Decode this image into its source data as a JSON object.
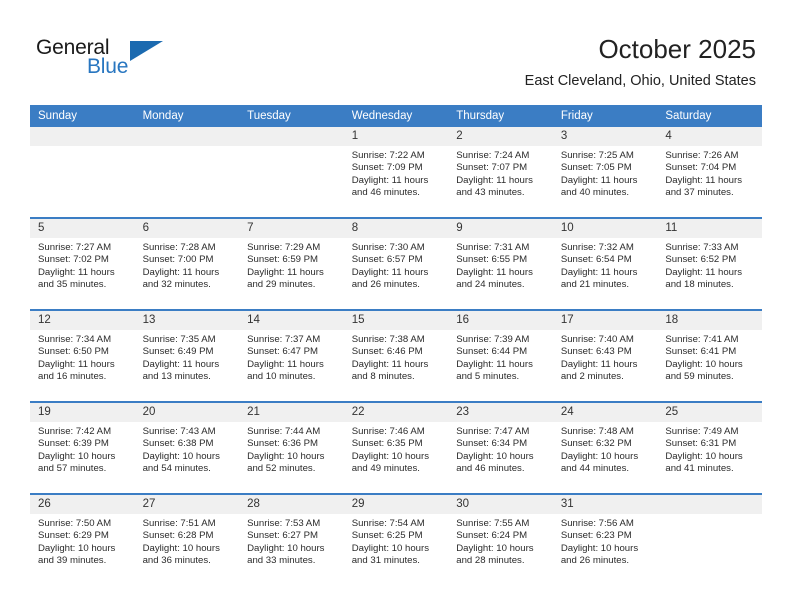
{
  "brand": {
    "name_part1": "General",
    "name_part2": "Blue",
    "triangle_icon": "triangle-icon",
    "accent_color": "#1b6ab0",
    "text_color": "#2876c0"
  },
  "header": {
    "title": "October 2025",
    "subtitle": "East Cleveland, Ohio, United States"
  },
  "calendar": {
    "header_bg": "#3b7dc4",
    "daynum_bg": "#f0f0f0",
    "weekdays": [
      "Sunday",
      "Monday",
      "Tuesday",
      "Wednesday",
      "Thursday",
      "Friday",
      "Saturday"
    ],
    "weeks": [
      [
        {
          "day": "",
          "lines": []
        },
        {
          "day": "",
          "lines": []
        },
        {
          "day": "",
          "lines": []
        },
        {
          "day": "1",
          "lines": [
            "Sunrise: 7:22 AM",
            "Sunset: 7:09 PM",
            "Daylight: 11 hours and 46 minutes."
          ]
        },
        {
          "day": "2",
          "lines": [
            "Sunrise: 7:24 AM",
            "Sunset: 7:07 PM",
            "Daylight: 11 hours and 43 minutes."
          ]
        },
        {
          "day": "3",
          "lines": [
            "Sunrise: 7:25 AM",
            "Sunset: 7:05 PM",
            "Daylight: 11 hours and 40 minutes."
          ]
        },
        {
          "day": "4",
          "lines": [
            "Sunrise: 7:26 AM",
            "Sunset: 7:04 PM",
            "Daylight: 11 hours and 37 minutes."
          ]
        }
      ],
      [
        {
          "day": "5",
          "lines": [
            "Sunrise: 7:27 AM",
            "Sunset: 7:02 PM",
            "Daylight: 11 hours and 35 minutes."
          ]
        },
        {
          "day": "6",
          "lines": [
            "Sunrise: 7:28 AM",
            "Sunset: 7:00 PM",
            "Daylight: 11 hours and 32 minutes."
          ]
        },
        {
          "day": "7",
          "lines": [
            "Sunrise: 7:29 AM",
            "Sunset: 6:59 PM",
            "Daylight: 11 hours and 29 minutes."
          ]
        },
        {
          "day": "8",
          "lines": [
            "Sunrise: 7:30 AM",
            "Sunset: 6:57 PM",
            "Daylight: 11 hours and 26 minutes."
          ]
        },
        {
          "day": "9",
          "lines": [
            "Sunrise: 7:31 AM",
            "Sunset: 6:55 PM",
            "Daylight: 11 hours and 24 minutes."
          ]
        },
        {
          "day": "10",
          "lines": [
            "Sunrise: 7:32 AM",
            "Sunset: 6:54 PM",
            "Daylight: 11 hours and 21 minutes."
          ]
        },
        {
          "day": "11",
          "lines": [
            "Sunrise: 7:33 AM",
            "Sunset: 6:52 PM",
            "Daylight: 11 hours and 18 minutes."
          ]
        }
      ],
      [
        {
          "day": "12",
          "lines": [
            "Sunrise: 7:34 AM",
            "Sunset: 6:50 PM",
            "Daylight: 11 hours and 16 minutes."
          ]
        },
        {
          "day": "13",
          "lines": [
            "Sunrise: 7:35 AM",
            "Sunset: 6:49 PM",
            "Daylight: 11 hours and 13 minutes."
          ]
        },
        {
          "day": "14",
          "lines": [
            "Sunrise: 7:37 AM",
            "Sunset: 6:47 PM",
            "Daylight: 11 hours and 10 minutes."
          ]
        },
        {
          "day": "15",
          "lines": [
            "Sunrise: 7:38 AM",
            "Sunset: 6:46 PM",
            "Daylight: 11 hours and 8 minutes."
          ]
        },
        {
          "day": "16",
          "lines": [
            "Sunrise: 7:39 AM",
            "Sunset: 6:44 PM",
            "Daylight: 11 hours and 5 minutes."
          ]
        },
        {
          "day": "17",
          "lines": [
            "Sunrise: 7:40 AM",
            "Sunset: 6:43 PM",
            "Daylight: 11 hours and 2 minutes."
          ]
        },
        {
          "day": "18",
          "lines": [
            "Sunrise: 7:41 AM",
            "Sunset: 6:41 PM",
            "Daylight: 10 hours and 59 minutes."
          ]
        }
      ],
      [
        {
          "day": "19",
          "lines": [
            "Sunrise: 7:42 AM",
            "Sunset: 6:39 PM",
            "Daylight: 10 hours and 57 minutes."
          ]
        },
        {
          "day": "20",
          "lines": [
            "Sunrise: 7:43 AM",
            "Sunset: 6:38 PM",
            "Daylight: 10 hours and 54 minutes."
          ]
        },
        {
          "day": "21",
          "lines": [
            "Sunrise: 7:44 AM",
            "Sunset: 6:36 PM",
            "Daylight: 10 hours and 52 minutes."
          ]
        },
        {
          "day": "22",
          "lines": [
            "Sunrise: 7:46 AM",
            "Sunset: 6:35 PM",
            "Daylight: 10 hours and 49 minutes."
          ]
        },
        {
          "day": "23",
          "lines": [
            "Sunrise: 7:47 AM",
            "Sunset: 6:34 PM",
            "Daylight: 10 hours and 46 minutes."
          ]
        },
        {
          "day": "24",
          "lines": [
            "Sunrise: 7:48 AM",
            "Sunset: 6:32 PM",
            "Daylight: 10 hours and 44 minutes."
          ]
        },
        {
          "day": "25",
          "lines": [
            "Sunrise: 7:49 AM",
            "Sunset: 6:31 PM",
            "Daylight: 10 hours and 41 minutes."
          ]
        }
      ],
      [
        {
          "day": "26",
          "lines": [
            "Sunrise: 7:50 AM",
            "Sunset: 6:29 PM",
            "Daylight: 10 hours and 39 minutes."
          ]
        },
        {
          "day": "27",
          "lines": [
            "Sunrise: 7:51 AM",
            "Sunset: 6:28 PM",
            "Daylight: 10 hours and 36 minutes."
          ]
        },
        {
          "day": "28",
          "lines": [
            "Sunrise: 7:53 AM",
            "Sunset: 6:27 PM",
            "Daylight: 10 hours and 33 minutes."
          ]
        },
        {
          "day": "29",
          "lines": [
            "Sunrise: 7:54 AM",
            "Sunset: 6:25 PM",
            "Daylight: 10 hours and 31 minutes."
          ]
        },
        {
          "day": "30",
          "lines": [
            "Sunrise: 7:55 AM",
            "Sunset: 6:24 PM",
            "Daylight: 10 hours and 28 minutes."
          ]
        },
        {
          "day": "31",
          "lines": [
            "Sunrise: 7:56 AM",
            "Sunset: 6:23 PM",
            "Daylight: 10 hours and 26 minutes."
          ]
        },
        {
          "day": "",
          "lines": []
        }
      ]
    ]
  }
}
